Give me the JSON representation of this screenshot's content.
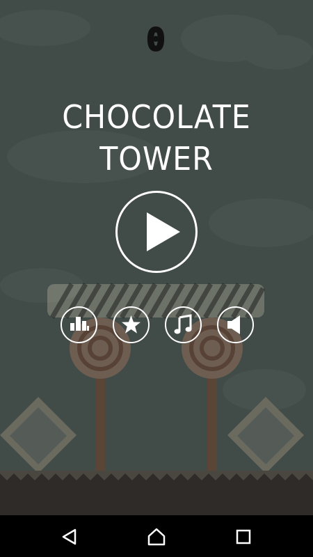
{
  "game": {
    "title": "CHOCOLATE TOWER",
    "score": "0"
  },
  "menu": {
    "buttons": [
      {
        "id": "play",
        "icon": "play-icon"
      },
      {
        "id": "leaderboard",
        "icon": "leaderboard-icon"
      },
      {
        "id": "rate",
        "icon": "star-icon"
      },
      {
        "id": "music",
        "icon": "music-note-icon"
      },
      {
        "id": "sound",
        "icon": "speaker-icon"
      }
    ]
  },
  "navbar": {
    "buttons": [
      "back-icon",
      "home-icon",
      "recents-icon"
    ]
  },
  "colors": {
    "overlay_background": "#414b47",
    "text": "#ffffff",
    "score": "#111111",
    "navbar": "#000000"
  }
}
